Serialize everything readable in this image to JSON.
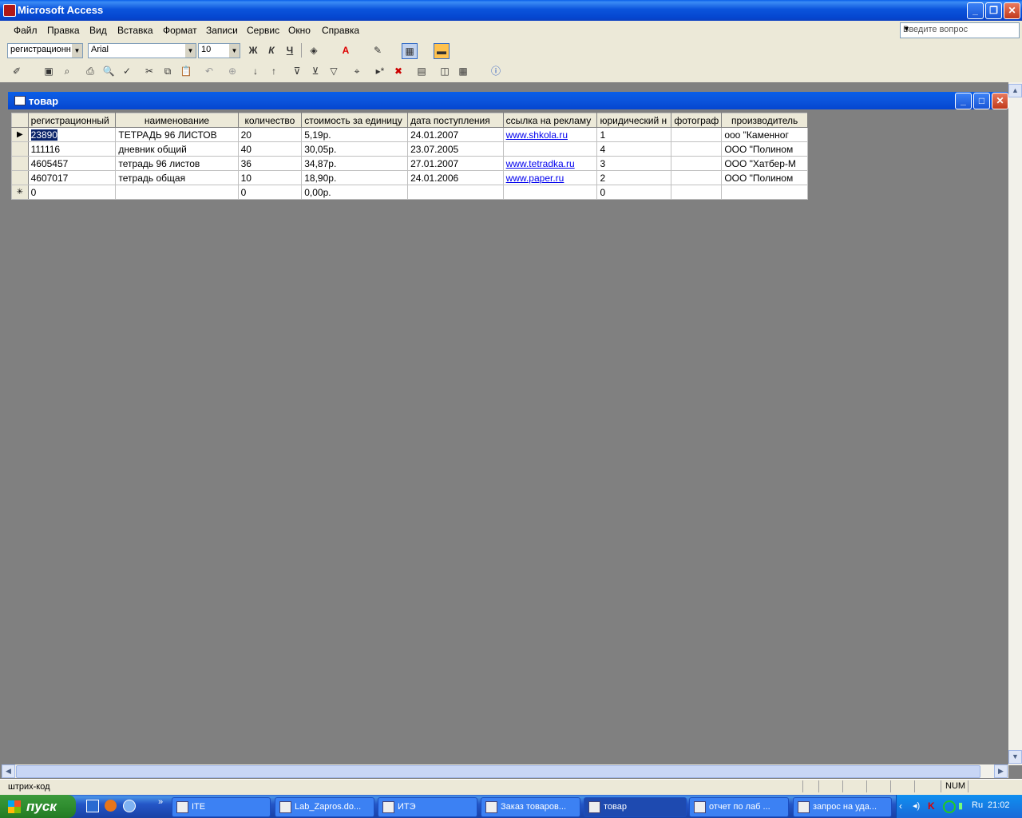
{
  "app": {
    "title": "Microsoft Access"
  },
  "menu": [
    "Файл",
    "Правка",
    "Вид",
    "Вставка",
    "Формат",
    "Записи",
    "Сервис",
    "Окно",
    "Справка"
  ],
  "ask_placeholder": "Введите вопрос",
  "format_toolbar": {
    "field": "регистрационн",
    "font": "Arial",
    "size": "10",
    "bold": "Ж",
    "italic": "К",
    "underline": "Ч"
  },
  "child": {
    "title": "товар"
  },
  "grid": {
    "columns": [
      "регистрационный",
      "наименование",
      "количество",
      "стоимость за единицу",
      "дата  поступления",
      "ссылка на рекламу",
      "юридический н",
      "фотограф",
      "производитель"
    ],
    "rows": [
      [
        "23890",
        "ТЕТРАДЬ 96 ЛИСТОВ",
        "20",
        "5,19р.",
        "24.01.2007",
        "www.shkola.ru",
        "1",
        "",
        "ооо \"Каменног"
      ],
      [
        "111116",
        "дневник общий",
        "40",
        "30,05р.",
        "23.07.2005",
        "",
        "4",
        "",
        "ООО \"Полином"
      ],
      [
        "4605457",
        "тетрадь 96 листов",
        "36",
        "34,87р.",
        "27.01.2007",
        "www.tetradka.ru",
        "3",
        "",
        "ООО \"Хатбер-М"
      ],
      [
        "4607017",
        "тетрадь общая",
        "10",
        "18,90р.",
        "24.01.2006",
        "www.paper.ru",
        "2",
        "",
        "ООО \"Полином"
      ],
      [
        "0",
        "",
        "0",
        "0,00р.",
        "",
        "",
        "0",
        "",
        ""
      ]
    ]
  },
  "status": {
    "text": "штрих-код",
    "num": "NUM"
  },
  "taskbar": {
    "start": "пуск",
    "tasks": [
      "ITE",
      "Lab_Zapros.do...",
      "ИТЭ",
      "Заказ товаров...",
      "товар",
      "отчет по лаб ...",
      "запрос на уда..."
    ],
    "lang": "Ru",
    "clock": "21:02"
  }
}
